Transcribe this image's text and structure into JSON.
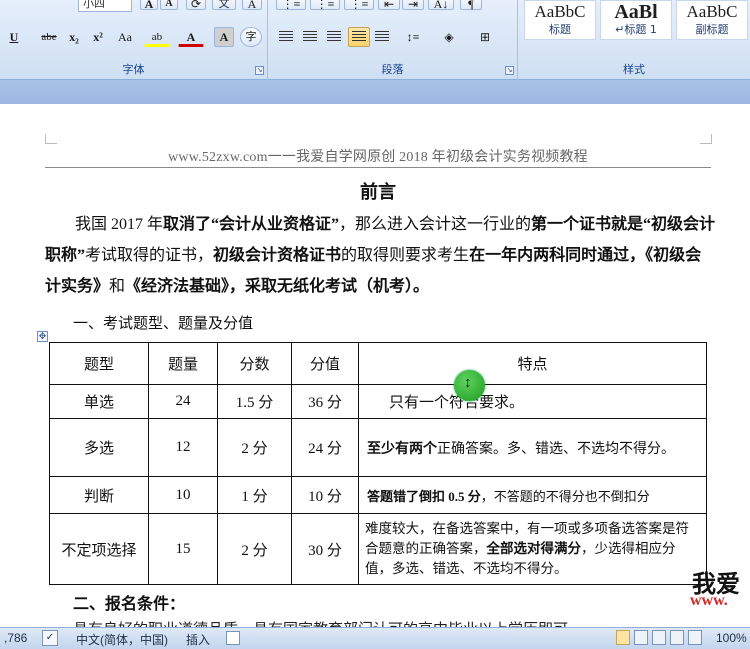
{
  "ribbon": {
    "font_group_label": "字体",
    "paragraph_group_label": "段落",
    "styles_group_label": "样式",
    "font_size_value": "小四",
    "styles": [
      {
        "sample": "AaBbC",
        "name": "标题"
      },
      {
        "sample": "AaBl",
        "name": "↵标题 1"
      },
      {
        "sample": "AaBbC",
        "name": "副标题"
      }
    ],
    "font_buttons": [
      "U",
      "abe",
      "x₂",
      "x²",
      "Aa",
      "A",
      "A",
      "字"
    ],
    "top_buttons": [
      "A",
      "A",
      "文",
      "A"
    ]
  },
  "document": {
    "header": "www.52zxw.com一一我爱自学网原创 2018 年初级会计实务视频教程",
    "title": "前言",
    "intro": [
      {
        "t": "我国 2017 年",
        "b": false
      },
      {
        "t": "取消了“会计从业资格证”",
        "b": true
      },
      {
        "t": "，那么进入会计这一行业的",
        "b": false
      },
      {
        "t": "第一个证书就是“初级会计职称”",
        "b": true
      },
      {
        "t": "考试取得的证书，",
        "b": false
      },
      {
        "t": "初级会计资格证书",
        "b": true
      },
      {
        "t": "的取得则要求考生",
        "b": false
      },
      {
        "t": "在一年内两科同时通过，《初级会计实务》",
        "b": true
      },
      {
        "t": "和",
        "b": false
      },
      {
        "t": "《经济法基础》，采取无纸化考试（机考）。",
        "b": true
      }
    ],
    "section1": "一、考试题型、题量及分值",
    "table": {
      "headers": [
        "题型",
        "题量",
        "分数",
        "分值",
        "特点"
      ],
      "rows": [
        {
          "type": "单选",
          "count": "24",
          "score": "1.5 分",
          "total": "36 分",
          "feature": [
            {
              "t": "只有一个符合要求。",
              "b": false
            }
          ]
        },
        {
          "type": "多选",
          "count": "12",
          "score": "2 分",
          "total": "24 分",
          "feature": [
            {
              "t": "至少有两个",
              "b": true
            },
            {
              "t": "正确答案。多、错选、不选均不得分。",
              "b": false
            }
          ]
        },
        {
          "type": "判断",
          "count": "10",
          "score": "1 分",
          "total": "10 分",
          "feature": [
            {
              "t": "答题错了倒扣 0.5 分",
              "b": true
            },
            {
              "t": "，不答题的不得分也不倒扣分",
              "b": false
            }
          ]
        },
        {
          "type": "不定项选择",
          "count": "15",
          "score": "2 分",
          "total": "30 分",
          "feature": [
            {
              "t": "难度较大，在备选答案中，有一项或多项备选答案是符合题意的正确答案，",
              "b": false
            },
            {
              "t": "全部选对得满分",
              "b": true
            },
            {
              "t": "，少选得相应分值，多选、错选、不选均不得分。",
              "b": false
            }
          ]
        }
      ]
    },
    "section2": "二、报名条件：",
    "cut_line": "具有良好的职业道德品质。具有国家教育部门认可的高中毕业以上学历即可",
    "logo_text": "我爱",
    "logo_url": "www."
  },
  "status": {
    "words": ",786",
    "language": "中文(简体，中国)",
    "mode": "插入",
    "zoom": "100%"
  }
}
